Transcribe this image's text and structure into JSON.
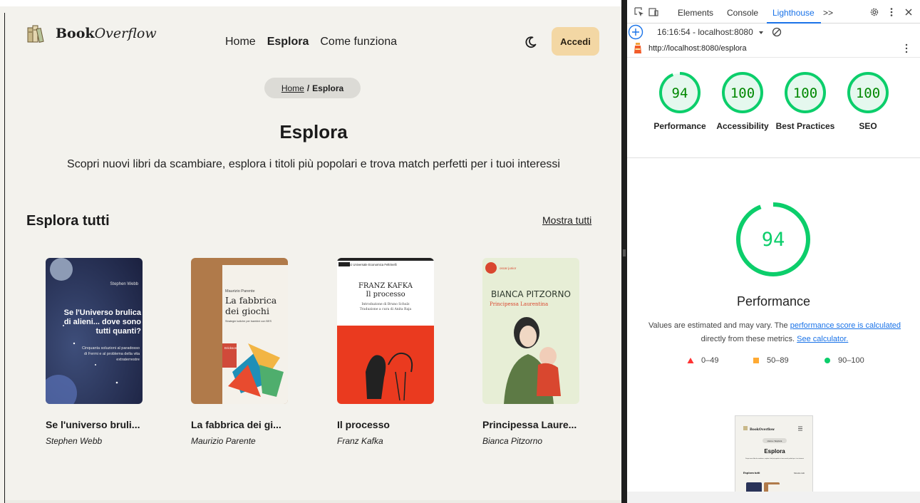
{
  "site": {
    "brand_bold": "Book",
    "brand_italic": "Overflow",
    "nav": {
      "home": "Home",
      "explore": "Esplora",
      "how": "Come funziona"
    },
    "login": "Accedi",
    "breadcrumb": {
      "home": "Home",
      "sep": "/",
      "current": "Esplora"
    },
    "title": "Esplora",
    "subtitle": "Scopri nuovi libri da scambiare, esplora i titoli più popolari e trova match perfetti per i tuoi interessi",
    "section_title": "Esplora tutti",
    "show_all": "Mostra tutti",
    "books": [
      {
        "title": "Se l'universo bruli...",
        "author": "Stephen Webb",
        "cover": {
          "author": "Stephen Webb",
          "line1": "Se l'Universo brulica",
          "line2": "di alieni... dove sono",
          "line3": "tutti quanti?",
          "line4": "Cinquanta soluzioni al paradosso",
          "line5": "di Fermi e al problema della vita",
          "line6": "extraterrestre"
        }
      },
      {
        "title": "La fabbrica dei gi...",
        "author": "Maurizio Parente",
        "cover": {
          "author": "Maurizio Parente",
          "line1": "La fabbrica",
          "line2": "dei giochi",
          "line3": "Strategie ludiche per bambini con BES",
          "publisher": "Erickson"
        }
      },
      {
        "title": "Il processo",
        "author": "Franz Kafka",
        "cover": {
          "series": "I Classici  Universale Economica Feltrinelli",
          "author": "FRANZ KAFKA",
          "line1": "Il processo",
          "line2": "Introduzione di Bruno Schulz",
          "line3": "Traduzione a cura di Anita Raja"
        }
      },
      {
        "title": "Principessa Laure...",
        "author": "Bianca Pitzorno",
        "cover": {
          "brand": "oscar junior",
          "author": "BIANCA PITZORNO",
          "line1": "Principessa Laurentina"
        }
      }
    ]
  },
  "devtools": {
    "tabs": [
      "Elements",
      "Console",
      "Lighthouse",
      ">>"
    ],
    "active_tab": "Lighthouse",
    "report": "16:16:54 - localhost:8080",
    "url": "http://localhost:8080/esplora",
    "scores": [
      {
        "value": "94",
        "label": "Performance"
      },
      {
        "value": "100",
        "label": "Accessibility"
      },
      {
        "value": "100",
        "label": "Best Practices"
      },
      {
        "value": "100",
        "label": "SEO"
      }
    ],
    "big_score": "94",
    "big_label": "Performance",
    "note_pre": "Values are estimated and may vary. The ",
    "note_link1": "performance score is calculated",
    "note_mid": " directly from these metrics. ",
    "note_link2": "See calculator.",
    "legend": [
      "0–49",
      "50–89",
      "90–100"
    ],
    "thumb": {
      "brand": "BookOverflow",
      "breadcrumb": "Home / Esplora",
      "title": "Esplora",
      "subtitle": "Scopri nuovi libri da scambiare, esplora i titoli più popolari e trova match perfetti per i tuoi interessi",
      "section": "Esplora tutti",
      "show_all": "Mostra tutti"
    }
  },
  "colors": {
    "site_bg": "#f3f2ed",
    "accent_button": "#f3d7a4",
    "score_green": "#0cce6b",
    "score_text": "#008800",
    "link_blue": "#1a73e8"
  }
}
